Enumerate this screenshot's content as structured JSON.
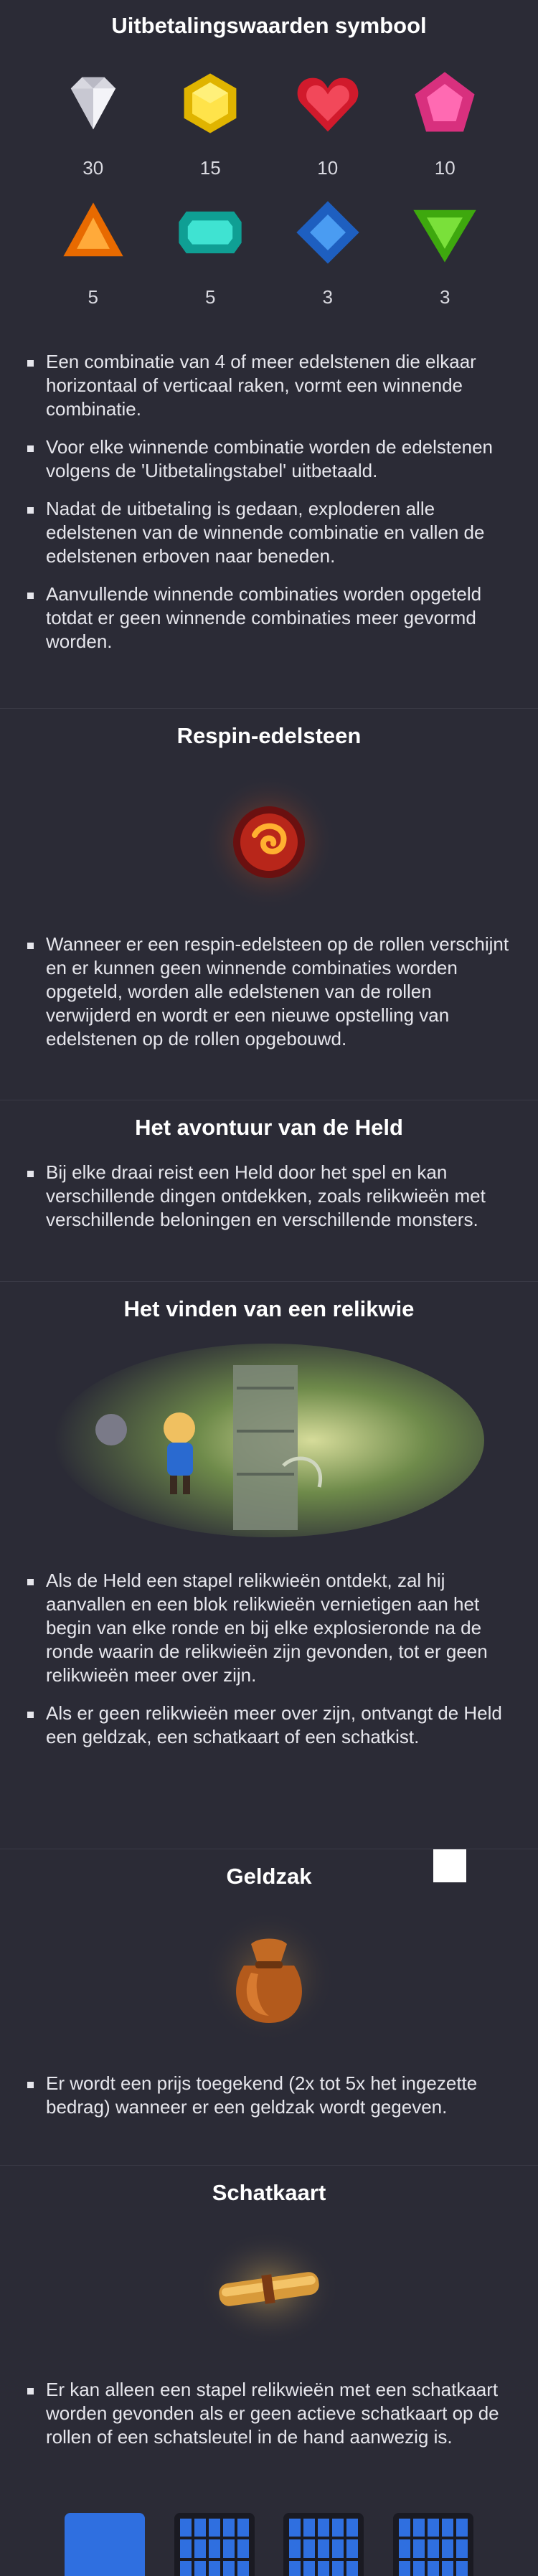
{
  "symbols": {
    "title": "Uitbetalingswaarden symbool",
    "gems": [
      {
        "icon": "white-diamond-icon",
        "value": "30",
        "color": "#e8e8ee"
      },
      {
        "icon": "yellow-gem-icon",
        "value": "15",
        "color": "#f2d21c"
      },
      {
        "icon": "red-heart-gem-icon",
        "value": "10",
        "color": "#e8283a"
      },
      {
        "icon": "pink-pentagon-gem-icon",
        "value": "10",
        "color": "#f04a9a"
      },
      {
        "icon": "orange-triangle-gem-icon",
        "value": "5",
        "color": "#ff8a1a"
      },
      {
        "icon": "teal-emerald-gem-icon",
        "value": "5",
        "color": "#1fc8b8"
      },
      {
        "icon": "blue-square-gem-icon",
        "value": "3",
        "color": "#2f7fe0"
      },
      {
        "icon": "green-triangle-gem-icon",
        "value": "3",
        "color": "#5bd21e"
      }
    ],
    "bullets": [
      "Een combinatie van 4 of meer edelstenen die elkaar horizontaal of verticaal raken, vormt een winnende combinatie.",
      "Voor elke winnende combinatie worden de edelstenen volgens de 'Uitbetalingstabel' uitbetaald.",
      "Nadat de uitbetaling is gedaan, exploderen alle edelstenen van de winnende combinatie en vallen de edelstenen erboven naar beneden.",
      "Aanvullende winnende combinaties worden opgeteld totdat er geen winnende combinaties meer gevormd worden."
    ]
  },
  "respin": {
    "title": "Respin-edelsteen",
    "bullets": [
      "Wanneer er een respin-edelsteen op de rollen verschijnt en er kunnen geen winnende combinaties worden opgeteld, worden alle edelstenen van de rollen verwijderd en wordt er een nieuwe opstelling van edelstenen op de rollen opgebouwd."
    ]
  },
  "adventure": {
    "title": "Het avontuur van de Held",
    "bullets": [
      "Bij elke draai reist een Held door het spel en kan verschillende dingen ontdekken, zoals relikwieën met verschillende beloningen en verschillende monsters."
    ]
  },
  "relic": {
    "title": "Het vinden van een relikwie",
    "bullets": [
      "Als de Held een stapel relikwieën ontdekt, zal hij aanvallen en een blok relikwieën vernietigen aan het begin van elke ronde en bij elke explosieronde na de ronde waarin de relikwieën zijn gevonden, tot er geen relikwieën meer over zijn.",
      "Als er geen relikwieën meer over zijn, ontvangt de Held een geldzak, een schatkaart of een schatkist."
    ]
  },
  "moneybag": {
    "title": "Geldzak",
    "bullets": [
      "Er wordt een prijs toegekend (2x tot 5x het ingezette bedrag) wanneer er een geldzak wordt gegeven."
    ]
  },
  "treasuremap": {
    "title": "Schatkaart",
    "bullets": [
      "Er kan alleen een stapel relikwieën met een schatkaart worden gevonden als er geen actieve schatkaart op de rollen of een schatsleutel in de hand aanwezig is."
    ]
  }
}
